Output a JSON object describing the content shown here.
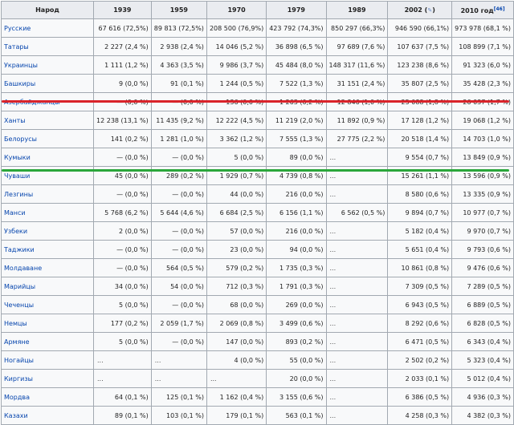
{
  "table": {
    "columns": {
      "nation": "Народ",
      "c1939": "1939",
      "c1959": "1959",
      "c1970": "1970",
      "c1979": "1979",
      "c1989": "1989",
      "c2002": "2002 (",
      "c2002_icon": "pin-icon",
      "c2002_close": ")",
      "c2010": "2010 год",
      "c2010_ref": "[46]"
    },
    "rows": [
      {
        "nation": "Русские",
        "c1939": "67 616 (72,5%)",
        "c1959": "89 813 (72,5%)",
        "c1970": "208 500 (76,9%)",
        "c1979": "423 792 (74,3%)",
        "c1989": "850 297 (66,3%)",
        "c2002": "946 590 (66,1%)",
        "c2010": "973 978 (68,1 %)"
      },
      {
        "nation": "Татары",
        "c1939": "2 227 (2,4 %)",
        "c1959": "2 938 (2,4 %)",
        "c1970": "14 046 (5,2 %)",
        "c1979": "36 898 (6,5 %)",
        "c1989": "97 689 (7,6 %)",
        "c2002": "107 637 (7,5 %)",
        "c2010": "108 899 (7,1 %)"
      },
      {
        "nation": "Украинцы",
        "c1939": "1 111 (1,2 %)",
        "c1959": "4 363 (3,5 %)",
        "c1970": "9 986 (3,7 %)",
        "c1979": "45 484 (8,0 %)",
        "c1989": "148 317 (11,6 %)",
        "c2002": "123 238 (8,6 %)",
        "c2010": "91 323 (6,0 %)"
      },
      {
        "nation": "Башкиры",
        "c1939": "9 (0,0 %)",
        "c1959": "91 (0,1 %)",
        "c1970": "1 244 (0,5 %)",
        "c1979": "7 522 (1,3 %)",
        "c1989": "31 151 (2,4 %)",
        "c2002": "35 807 (2,5 %)",
        "c2010": "35 428 (2,3 %)"
      },
      {
        "nation": "Азербайджанцы",
        "c1939": "— (0,0 %)",
        "c1959": "— (0,0 %)",
        "c1970": "136 (0,0 %)",
        "c1979": "1 263 (0,2 %)",
        "c1989": "12 846 (1,0 %)",
        "c2002": "25 088 (1,8 %)",
        "c2010": "26 037 (1,7 %)"
      },
      {
        "nation": "Ханты",
        "c1939": "12 238 (13,1 %)",
        "c1959": "11 435 (9,2 %)",
        "c1970": "12 222 (4,5 %)",
        "c1979": "11 219 (2,0 %)",
        "c1989": "11 892 (0,9 %)",
        "c2002": "17 128 (1,2 %)",
        "c2010": "19 068 (1,2 %)"
      },
      {
        "nation": "Белорусы",
        "c1939": "141 (0,2 %)",
        "c1959": "1 281 (1,0 %)",
        "c1970": "3 362 (1,2 %)",
        "c1979": "7 555 (1,3 %)",
        "c1989": "27 775 (2,2 %)",
        "c2002": "20 518 (1,4 %)",
        "c2010": "14 703 (1,0 %)"
      },
      {
        "nation": "Кумыки",
        "c1939": "— (0,0 %)",
        "c1959": "— (0,0 %)",
        "c1970": "5 (0,0 %)",
        "c1979": "89 (0,0 %)",
        "c1989": "...",
        "c2002": "9 554 (0,7 %)",
        "c2010": "13 849 (0,9 %)"
      },
      {
        "nation": "Чуваши",
        "c1939": "45 (0,0 %)",
        "c1959": "289 (0,2 %)",
        "c1970": "1 929 (0,7 %)",
        "c1979": "4 739 (0,8 %)",
        "c1989": "...",
        "c2002": "15 261 (1,1 %)",
        "c2010": "13 596 (0,9 %)"
      },
      {
        "nation": "Лезгины",
        "c1939": "— (0,0 %)",
        "c1959": "— (0,0 %)",
        "c1970": "44 (0,0 %)",
        "c1979": "216 (0,0 %)",
        "c1989": "...",
        "c2002": "8 580 (0,6 %)",
        "c2010": "13 335 (0,9 %)"
      },
      {
        "nation": "Манси",
        "c1939": "5 768 (6,2 %)",
        "c1959": "5 644 (4,6 %)",
        "c1970": "6 684 (2,5 %)",
        "c1979": "6 156 (1,1 %)",
        "c1989": "6 562 (0,5 %)",
        "c2002": "9 894 (0,7 %)",
        "c2010": "10 977 (0,7 %)"
      },
      {
        "nation": "Узбеки",
        "c1939": "2 (0,0 %)",
        "c1959": "— (0,0 %)",
        "c1970": "57 (0,0 %)",
        "c1979": "216 (0,0 %)",
        "c1989": "...",
        "c2002": "5 182 (0,4 %)",
        "c2010": "9 970 (0,7 %)"
      },
      {
        "nation": "Таджики",
        "c1939": "— (0,0 %)",
        "c1959": "— (0,0 %)",
        "c1970": "23 (0,0 %)",
        "c1979": "94 (0,0 %)",
        "c1989": "...",
        "c2002": "5 651 (0,4 %)",
        "c2010": "9 793 (0,6 %)"
      },
      {
        "nation": "Молдаване",
        "c1939": "— (0,0 %)",
        "c1959": "564 (0,5 %)",
        "c1970": "579 (0,2 %)",
        "c1979": "1 735 (0,3 %)",
        "c1989": "...",
        "c2002": "10 861 (0,8 %)",
        "c2010": "9 476 (0,6 %)"
      },
      {
        "nation": "Марийцы",
        "c1939": "34 (0,0 %)",
        "c1959": "54 (0,0 %)",
        "c1970": "712 (0,3 %)",
        "c1979": "1 791 (0,3 %)",
        "c1989": "...",
        "c2002": "7 309 (0,5 %)",
        "c2010": "7 289 (0,5 %)"
      },
      {
        "nation": "Чеченцы",
        "c1939": "5 (0,0 %)",
        "c1959": "— (0,0 %)",
        "c1970": "68 (0,0 %)",
        "c1979": "269 (0,0 %)",
        "c1989": "...",
        "c2002": "6 943 (0,5 %)",
        "c2010": "6 889 (0,5 %)"
      },
      {
        "nation": "Немцы",
        "c1939": "177 (0,2 %)",
        "c1959": "2 059 (1,7 %)",
        "c1970": "2 069 (0,8 %)",
        "c1979": "3 499 (0,6 %)",
        "c1989": "...",
        "c2002": "8 292 (0,6 %)",
        "c2010": "6 828 (0,5 %)"
      },
      {
        "nation": "Армяне",
        "c1939": "5 (0,0 %)",
        "c1959": "— (0,0 %)",
        "c1970": "147 (0,0 %)",
        "c1979": "893 (0,2 %)",
        "c1989": "...",
        "c2002": "6 471 (0,5 %)",
        "c2010": "6 343 (0,4 %)"
      },
      {
        "nation": "Ногайцы",
        "c1939": "...",
        "c1959": "...",
        "c1970": "4 (0,0 %)",
        "c1979": "55 (0,0 %)",
        "c1989": "...",
        "c2002": "2 502 (0,2 %)",
        "c2010": "5 323 (0,4 %)"
      },
      {
        "nation": "Киргизы",
        "c1939": "...",
        "c1959": "...",
        "c1970": "...",
        "c1979": "20 (0,0 %)",
        "c1989": "...",
        "c2002": "2 033 (0,1 %)",
        "c2010": "5 012 (0,4 %)"
      },
      {
        "nation": "Мордва",
        "c1939": "64 (0,1 %)",
        "c1959": "125 (0,1 %)",
        "c1970": "1 162 (0,4 %)",
        "c1979": "3 155 (0,6 %)",
        "c1989": "...",
        "c2002": "6 386 (0,5 %)",
        "c2010": "4 936 (0,3 %)"
      },
      {
        "nation": "Казахи",
        "c1939": "89 (0,1 %)",
        "c1959": "103 (0,1 %)",
        "c1970": "179 (0,1 %)",
        "c1979": "563 (0,1 %)",
        "c1989": "...",
        "c2002": "4 258 (0,3 %)",
        "c2010": "4 382 (0,3 %)"
      }
    ]
  },
  "highlights": {
    "red_color": "#d9232a",
    "green_color": "#2aa63a",
    "red_row": "Ханты",
    "green_row": "Манси"
  }
}
